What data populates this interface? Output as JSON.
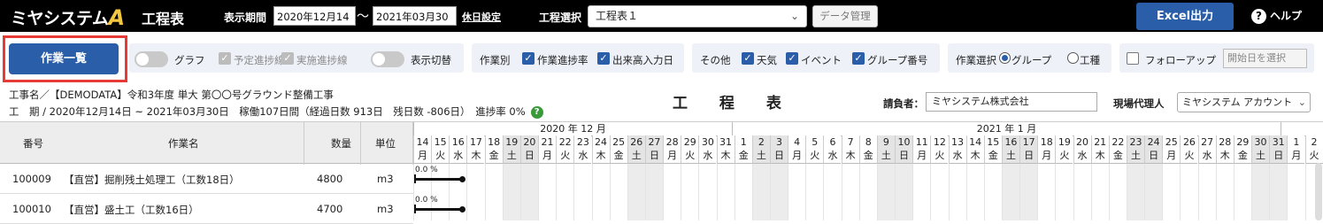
{
  "app": {
    "logo_text": "ミヤシステム",
    "logo_mark": "A",
    "title": "工程表",
    "period_label": "表示期間",
    "date_from": "2020年12月14日",
    "tilde": "〜",
    "date_to": "2021年03月30日",
    "holiday_link": "休日設定",
    "schedule_label": "工程選択",
    "schedule_value": "工程表１",
    "data_manage_label": "データ管理",
    "excel_label": "Excel出力",
    "help_label": "ヘルプ"
  },
  "toolbar": {
    "work_list_label": "作業一覧",
    "graph_label": "グラフ",
    "planned_progress_label": "予定進捗線",
    "actual_progress_label": "実施進捗線",
    "display_toggle_label": "表示切替",
    "by_work_label": "作業別",
    "work_progress_label": "作業進捗率",
    "output_date_label": "出来高入力日",
    "other_label": "その他",
    "weather_label": "天気",
    "event_label": "イベント",
    "group_number_label": "グループ番号",
    "work_select_label": "作業選択",
    "group_radio_label": "グループ",
    "process_radio_label": "工種",
    "followup_label": "フォローアップ",
    "start_date_placeholder": "開始日を選択"
  },
  "info": {
    "project_line": "工事名／【DEMODATA】令和3年度 単大 第〇〇号グラウンド整備工事",
    "period_line": "工　期 / 2020年12月14日 ~ 2021年03月30日　稼働107日間（経過日数 913日　残日数 -806日）　進捗率 0%",
    "help_mark": "?",
    "center_title": "工 程 表",
    "contractor_label": "請負者：",
    "contractor_value": "ミヤシステム株式会社",
    "agent_label": "現場代理人",
    "agent_value": "ミヤシステム アカウント"
  },
  "grid": {
    "headers": {
      "number": "番号",
      "name": "作業名",
      "qty": "数量",
      "unit": "単位"
    },
    "months": [
      "2020 年 12 月",
      "2021 年 1 月"
    ],
    "days": [
      {
        "d": "14",
        "w": "月"
      },
      {
        "d": "15",
        "w": "火"
      },
      {
        "d": "16",
        "w": "水"
      },
      {
        "d": "17",
        "w": "木"
      },
      {
        "d": "18",
        "w": "金"
      },
      {
        "d": "19",
        "w": "土"
      },
      {
        "d": "20",
        "w": "日"
      },
      {
        "d": "21",
        "w": "月"
      },
      {
        "d": "22",
        "w": "火"
      },
      {
        "d": "23",
        "w": "水"
      },
      {
        "d": "24",
        "w": "木"
      },
      {
        "d": "25",
        "w": "金"
      },
      {
        "d": "26",
        "w": "土"
      },
      {
        "d": "27",
        "w": "日"
      },
      {
        "d": "28",
        "w": "月"
      },
      {
        "d": "29",
        "w": "火"
      },
      {
        "d": "30",
        "w": "水"
      },
      {
        "d": "31",
        "w": "木"
      },
      {
        "d": "1",
        "w": "金"
      },
      {
        "d": "2",
        "w": "土"
      },
      {
        "d": "3",
        "w": "日"
      },
      {
        "d": "4",
        "w": "月"
      },
      {
        "d": "5",
        "w": "火"
      },
      {
        "d": "6",
        "w": "水"
      },
      {
        "d": "7",
        "w": "木"
      },
      {
        "d": "8",
        "w": "金"
      },
      {
        "d": "9",
        "w": "土"
      },
      {
        "d": "10",
        "w": "日"
      },
      {
        "d": "11",
        "w": "月"
      },
      {
        "d": "12",
        "w": "火"
      },
      {
        "d": "13",
        "w": "水"
      },
      {
        "d": "14",
        "w": "木"
      },
      {
        "d": "15",
        "w": "金"
      },
      {
        "d": "16",
        "w": "土"
      },
      {
        "d": "17",
        "w": "日"
      },
      {
        "d": "18",
        "w": "月"
      },
      {
        "d": "19",
        "w": "火"
      },
      {
        "d": "20",
        "w": "水"
      },
      {
        "d": "21",
        "w": "木"
      },
      {
        "d": "22",
        "w": "金"
      },
      {
        "d": "23",
        "w": "土"
      },
      {
        "d": "24",
        "w": "日"
      },
      {
        "d": "25",
        "w": "月"
      },
      {
        "d": "26",
        "w": "火"
      },
      {
        "d": "27",
        "w": "水"
      },
      {
        "d": "28",
        "w": "木"
      },
      {
        "d": "29",
        "w": "金"
      },
      {
        "d": "30",
        "w": "土"
      },
      {
        "d": "31",
        "w": "日"
      },
      {
        "d": "1",
        "w": "月"
      },
      {
        "d": "2",
        "w": "火"
      }
    ],
    "rows": [
      {
        "number": "100009",
        "name": "【直営】掘削残土処理工（工数18日）",
        "qty": "4800",
        "unit": "m3",
        "pct": "0.0 %"
      },
      {
        "number": "100010",
        "name": "【直営】盛土工（工数16日）",
        "qty": "4700",
        "unit": "m3",
        "pct": "0.0 %"
      }
    ]
  }
}
